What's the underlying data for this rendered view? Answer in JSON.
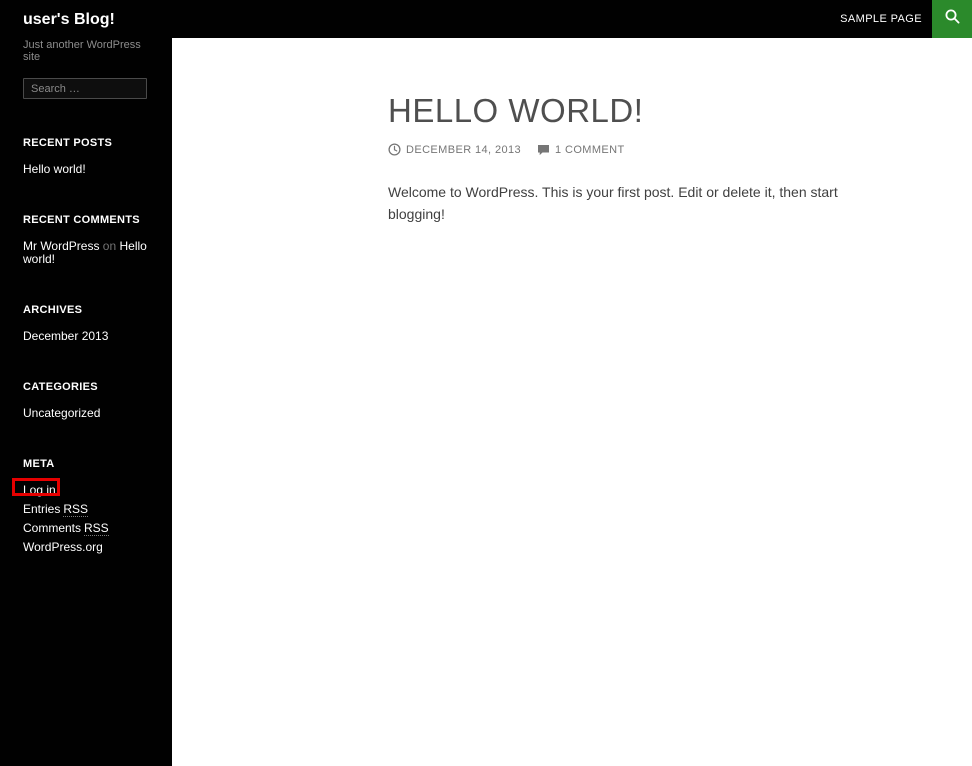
{
  "colors": {
    "topbar_bg": "#010101",
    "sidebar_bg": "#010101",
    "accent_green": "#2b8a2b",
    "annotation_red": "#e60000"
  },
  "topbar": {
    "nav_items": [
      {
        "label": "SAMPLE PAGE"
      }
    ],
    "search_icon": "search-icon"
  },
  "sidebar": {
    "site_title": "user's Blog!",
    "tagline": "Just another WordPress site",
    "search": {
      "placeholder": "Search …"
    },
    "recent_posts": {
      "heading": "RECENT POSTS",
      "items": [
        {
          "label": "Hello world!"
        }
      ]
    },
    "recent_comments": {
      "heading": "RECENT COMMENTS",
      "items": [
        {
          "author": "Mr WordPress",
          "connector": "on",
          "post": "Hello world!"
        }
      ]
    },
    "archives": {
      "heading": "ARCHIVES",
      "items": [
        {
          "label": "December 2013"
        }
      ]
    },
    "categories": {
      "heading": "CATEGORIES",
      "items": [
        {
          "label": "Uncategorized"
        }
      ]
    },
    "meta": {
      "heading": "META",
      "items": [
        {
          "label": "Log in"
        },
        {
          "label": "Entries",
          "abbr": "RSS"
        },
        {
          "label": "Comments",
          "abbr": "RSS"
        },
        {
          "label": "WordPress.org"
        }
      ]
    }
  },
  "post": {
    "title": "HELLO WORLD!",
    "date": "DECEMBER 14, 2013",
    "comments": "1 COMMENT",
    "body": "Welcome to WordPress. This is your first post. Edit or delete it, then start blogging!"
  }
}
